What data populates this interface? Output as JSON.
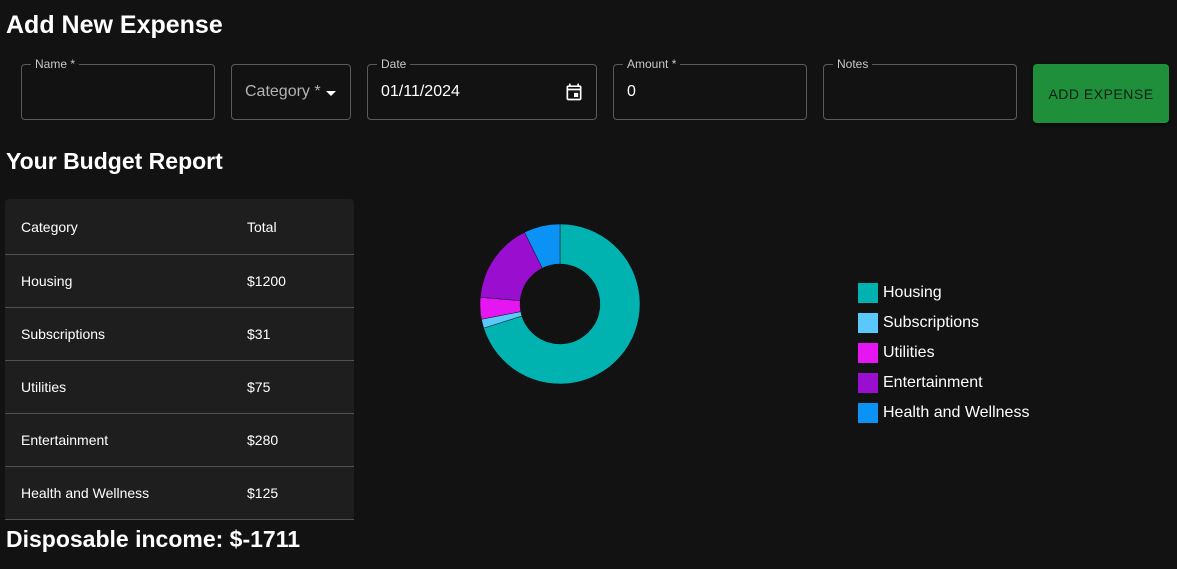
{
  "form": {
    "title": "Add New Expense",
    "name_label": "Name *",
    "name_value": "",
    "category_label": "Category *",
    "date_label": "Date",
    "date_value": "01/11/2024",
    "amount_label": "Amount *",
    "amount_value": "0",
    "notes_label": "Notes",
    "notes_value": "",
    "add_button": "ADD EXPENSE"
  },
  "report": {
    "title": "Your Budget Report",
    "headers": {
      "category": "Category",
      "total": "Total"
    },
    "rows": [
      {
        "category": "Housing",
        "total": "$1200"
      },
      {
        "category": "Subscriptions",
        "total": "$31"
      },
      {
        "category": "Utilities",
        "total": "$75"
      },
      {
        "category": "Entertainment",
        "total": "$280"
      },
      {
        "category": "Health and Wellness",
        "total": "$125"
      }
    ],
    "disposable": "Disposable income: $-1711"
  },
  "colors": {
    "Housing": "#00b3b0",
    "Subscriptions": "#5ac8fa",
    "Utilities": "#e516f2",
    "Entertainment": "#9a0fcf",
    "Health and Wellness": "#0a93f5",
    "add_button": "#1f8f3c"
  },
  "chart_data": {
    "type": "pie",
    "style": "donut",
    "categories": [
      "Housing",
      "Subscriptions",
      "Utilities",
      "Entertainment",
      "Health and Wellness"
    ],
    "values": [
      1200,
      31,
      75,
      280,
      125
    ],
    "legend": "right"
  }
}
